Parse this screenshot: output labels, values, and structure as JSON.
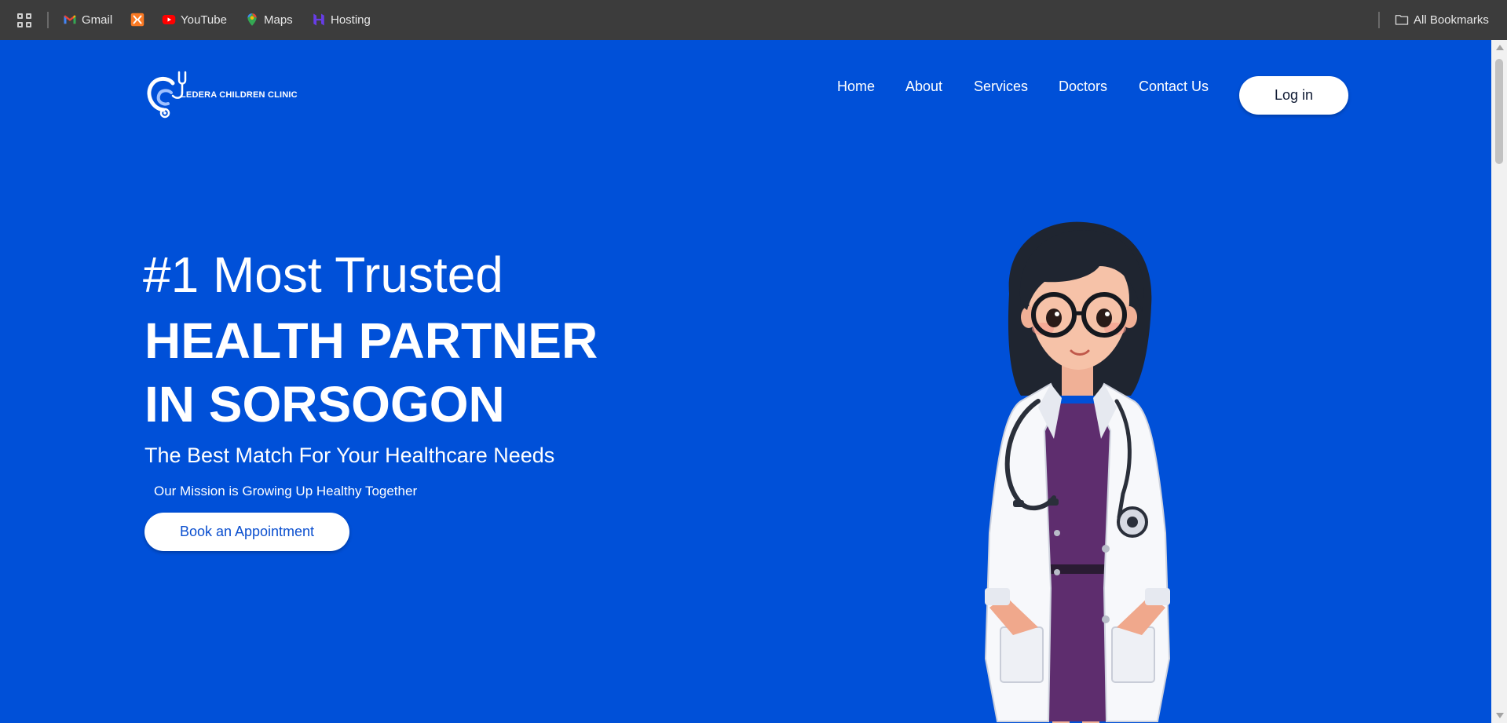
{
  "bookmarks_bar": {
    "items": [
      {
        "label": "Gmail",
        "icon": "gmail-icon"
      },
      {
        "label": "",
        "icon": "xampp-icon"
      },
      {
        "label": "YouTube",
        "icon": "youtube-icon"
      },
      {
        "label": "Maps",
        "icon": "maps-icon"
      },
      {
        "label": "Hosting",
        "icon": "hostinger-icon"
      }
    ],
    "all_bookmarks": "All Bookmarks"
  },
  "navbar": {
    "logo_text": "LEDERA CHILDREN CLINIC",
    "links": [
      "Home",
      "About",
      "Services",
      "Doctors",
      "Contact Us"
    ],
    "login_label": "Log in"
  },
  "hero": {
    "headline_line1": "#1 Most Trusted",
    "headline_line2": "HEALTH PARTNER",
    "headline_line3": "IN SORSOGON",
    "subtitle": "The Best Match For Your Healthcare Needs",
    "mission": "Our Mission is Growing Up Healthy Together",
    "cta_label": "Book an Appointment"
  },
  "colors": {
    "page_background": "#0050d8",
    "bookmarks_bar": "#3c3c3c",
    "button_background": "#ffffff",
    "cta_text": "#0b4fcf"
  }
}
